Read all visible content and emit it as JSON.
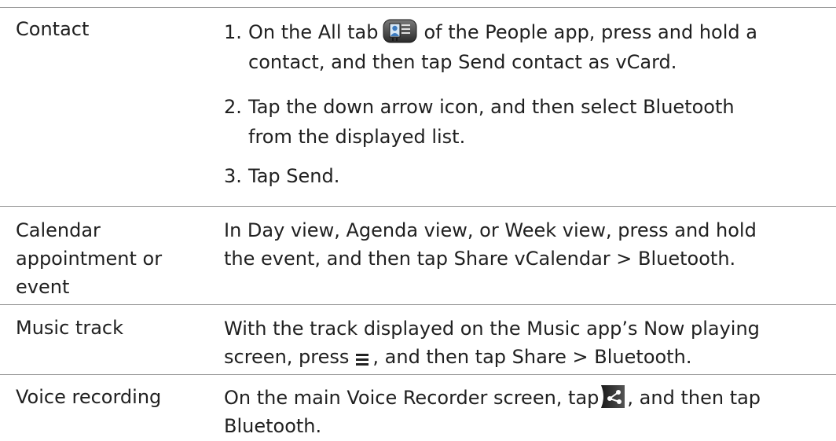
{
  "rows": [
    {
      "label": "Contact",
      "steps": [
        {
          "number": "1.",
          "prefix": "On the All tab",
          "icon": "people-app-icon",
          "part1": "of the People app, press and hold a",
          "part2_plain": "contact, and then tap",
          "part2_bold": "Send contact as vCard",
          "part2_end": "."
        },
        {
          "number": "2.",
          "part1_plain": "Tap the down arrow icon, and then select",
          "part1_bold": "Bluetooth",
          "part2": "from the displayed list."
        },
        {
          "number": "3.",
          "plain": "Tap",
          "bold": "Send",
          "end": "."
        }
      ]
    },
    {
      "label_line1": "Calendar",
      "label_line2": "appointment or",
      "label_line3": "event",
      "line1": "In Day view, Agenda view, or Week view, press and hold",
      "line2_plain": "the event, and then tap",
      "line2_bold1": "Share vCalendar",
      "line2_sep": " > ",
      "line2_bold2": "Bluetooth",
      "line2_end": "."
    },
    {
      "label": "Music track",
      "line1": "With the track displayed on the Music app’s Now playing",
      "line2_plain": "screen, press",
      "icon": "menu-icon",
      "line2_mid": ", and then tap",
      "line2_bold1": "Share",
      "line2_sep": " > ",
      "line2_bold2": "Bluetooth",
      "line2_end": "."
    },
    {
      "label": "Voice recording",
      "line1_plain": "On the main Voice Recorder screen, tap",
      "icon": "share-icon",
      "line1_end": ", and then tap",
      "line2_bold": "Bluetooth",
      "line2_end": "."
    }
  ]
}
